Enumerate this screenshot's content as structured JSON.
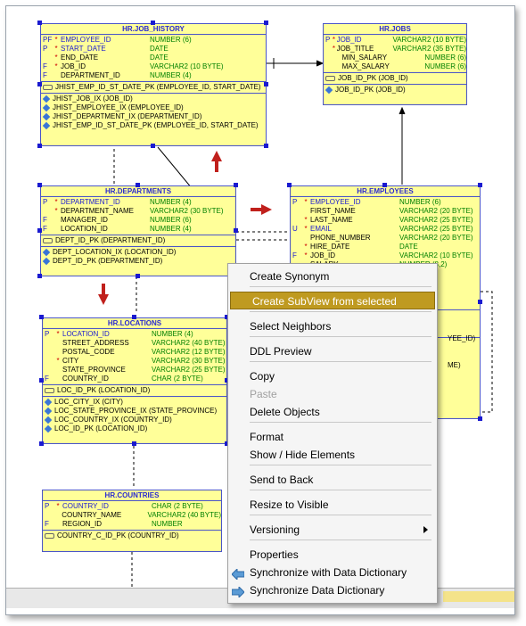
{
  "tables": {
    "job_history": {
      "title": "HR.JOB_HISTORY",
      "columns": [
        {
          "key": "PF",
          "star": "*",
          "name": "EMPLOYEE_ID",
          "type": "NUMBER (6)",
          "blue": true
        },
        {
          "key": "P",
          "star": "*",
          "name": "START_DATE",
          "type": "DATE",
          "blue": true
        },
        {
          "key": "",
          "star": "*",
          "name": "END_DATE",
          "type": "DATE",
          "blue": false
        },
        {
          "key": "F",
          "star": "*",
          "name": "JOB_ID",
          "type": "VARCHAR2 (10 BYTE)",
          "blue": false
        },
        {
          "key": "F",
          "star": "",
          "name": "DEPARTMENT_ID",
          "type": "NUMBER (4)",
          "blue": false
        }
      ],
      "pk": [
        "JHIST_EMP_ID_ST_DATE_PK (EMPLOYEE_ID, START_DATE)"
      ],
      "indexes": [
        "JHIST_JOB_IX (JOB_ID)",
        "JHIST_EMPLOYEE_IX (EMPLOYEE_ID)",
        "JHIST_DEPARTMENT_IX (DEPARTMENT_ID)",
        "JHIST_EMP_ID_ST_DATE_PK (EMPLOYEE_ID, START_DATE)"
      ]
    },
    "jobs": {
      "title": "HR.JOBS",
      "columns": [
        {
          "key": "P",
          "star": "*",
          "name": "JOB_ID",
          "type": "VARCHAR2 (10 BYTE)",
          "blue": true
        },
        {
          "key": "",
          "star": "*",
          "name": "JOB_TITLE",
          "type": "VARCHAR2 (35 BYTE)",
          "blue": false
        },
        {
          "key": "",
          "star": "",
          "name": "MIN_SALARY",
          "type": "NUMBER (6)",
          "blue": false
        },
        {
          "key": "",
          "star": "",
          "name": "MAX_SALARY",
          "type": "NUMBER (6)",
          "blue": false
        }
      ],
      "pk": [
        "JOB_ID_PK (JOB_ID)"
      ],
      "indexes": [
        "JOB_ID_PK (JOB_ID)"
      ]
    },
    "departments": {
      "title": "HR.DEPARTMENTS",
      "columns": [
        {
          "key": "P",
          "star": "*",
          "name": "DEPARTMENT_ID",
          "type": "NUMBER (4)",
          "blue": true
        },
        {
          "key": "",
          "star": "*",
          "name": "DEPARTMENT_NAME",
          "type": "VARCHAR2 (30 BYTE)",
          "blue": false
        },
        {
          "key": "F",
          "star": "",
          "name": "MANAGER_ID",
          "type": "NUMBER (6)",
          "blue": false
        },
        {
          "key": "F",
          "star": "",
          "name": "LOCATION_ID",
          "type": "NUMBER (4)",
          "blue": false
        }
      ],
      "pk": [
        "DEPT_ID_PK (DEPARTMENT_ID)"
      ],
      "indexes": [
        "DEPT_LOCATION_IX (LOCATION_ID)",
        "DEPT_ID_PK (DEPARTMENT_ID)"
      ]
    },
    "employees": {
      "title": "HR.EMPLOYEES",
      "columns": [
        {
          "key": "P",
          "star": "*",
          "name": "EMPLOYEE_ID",
          "type": "NUMBER (6)",
          "blue": true
        },
        {
          "key": "",
          "star": "",
          "name": "FIRST_NAME",
          "type": "VARCHAR2 (20 BYTE)",
          "blue": false
        },
        {
          "key": "",
          "star": "*",
          "name": "LAST_NAME",
          "type": "VARCHAR2 (25 BYTE)",
          "blue": false
        },
        {
          "key": "U",
          "star": "*",
          "name": "EMAIL",
          "type": "VARCHAR2 (25 BYTE)",
          "blue": true
        },
        {
          "key": "",
          "star": "",
          "name": "PHONE_NUMBER",
          "type": "VARCHAR2 (20 BYTE)",
          "blue": false
        },
        {
          "key": "",
          "star": "*",
          "name": "HIRE_DATE",
          "type": "DATE",
          "blue": false
        },
        {
          "key": "F",
          "star": "*",
          "name": "JOB_ID",
          "type": "VARCHAR2 (10 BYTE)",
          "blue": false
        },
        {
          "key": "",
          "star": "",
          "name": "SALARY",
          "type": "NUMBER (8,2)",
          "blue": false
        }
      ],
      "partial": [
        "YEE_ID)",
        "ME)"
      ]
    },
    "locations": {
      "title": "HR.LOCATIONS",
      "columns": [
        {
          "key": "P",
          "star": "*",
          "name": "LOCATION_ID",
          "type": "NUMBER (4)",
          "blue": true
        },
        {
          "key": "",
          "star": "",
          "name": "STREET_ADDRESS",
          "type": "VARCHAR2 (40 BYTE)",
          "blue": false
        },
        {
          "key": "",
          "star": "",
          "name": "POSTAL_CODE",
          "type": "VARCHAR2 (12 BYTE)",
          "blue": false
        },
        {
          "key": "",
          "star": "*",
          "name": "CITY",
          "type": "VARCHAR2 (30 BYTE)",
          "blue": false
        },
        {
          "key": "",
          "star": "",
          "name": "STATE_PROVINCE",
          "type": "VARCHAR2 (25 BYTE)",
          "blue": false
        },
        {
          "key": "F",
          "star": "",
          "name": "COUNTRY_ID",
          "type": "CHAR (2 BYTE)",
          "blue": false
        }
      ],
      "pk": [
        "LOC_ID_PK (LOCATION_ID)"
      ],
      "indexes": [
        "LOC_CITY_IX (CITY)",
        "LOC_STATE_PROVINCE_IX (STATE_PROVINCE)",
        "LOC_COUNTRY_IX (COUNTRY_ID)",
        "LOC_ID_PK (LOCATION_ID)"
      ]
    },
    "countries": {
      "title": "HR.COUNTRIES",
      "columns": [
        {
          "key": "P",
          "star": "*",
          "name": "COUNTRY_ID",
          "type": "CHAR (2 BYTE)",
          "blue": true
        },
        {
          "key": "",
          "star": "",
          "name": "COUNTRY_NAME",
          "type": "VARCHAR2 (40 BYTE)",
          "blue": false
        },
        {
          "key": "F",
          "star": "",
          "name": "REGION_ID",
          "type": "NUMBER",
          "blue": false
        }
      ],
      "pk": [
        "COUNTRY_C_ID_PK (COUNTRY_ID)"
      ]
    }
  },
  "context_menu": {
    "items": [
      {
        "label": "Create Synonym",
        "state": "normal"
      },
      {
        "label": "Create SubView from selected",
        "state": "selected"
      },
      {
        "label": "Select Neighbors",
        "state": "normal"
      },
      {
        "label": "DDL Preview",
        "state": "normal"
      },
      {
        "label": "Copy",
        "state": "normal"
      },
      {
        "label": "Paste",
        "state": "disabled"
      },
      {
        "label": "Delete Objects",
        "state": "normal"
      },
      {
        "label": "Format",
        "state": "normal"
      },
      {
        "label": "Show / Hide Elements",
        "state": "normal"
      },
      {
        "label": "Send to Back",
        "state": "normal"
      },
      {
        "label": "Resize to Visible",
        "state": "normal"
      },
      {
        "label": "Versioning",
        "state": "submenu"
      },
      {
        "label": "Properties",
        "state": "normal"
      },
      {
        "label": "Synchronize with Data Dictionary",
        "state": "normal",
        "icon": "sync-left-arrow-icon"
      },
      {
        "label": "Synchronize Data Dictionary",
        "state": "normal",
        "icon": "sync-right-arrow-icon"
      }
    ]
  },
  "colors": {
    "table_fill": "#ffff99",
    "table_border": "#4a55c8",
    "title": "#2a2ad0",
    "type": "#008000",
    "menu_highlight": "#bf9a20",
    "annotation_arrow": "#c0201c"
  }
}
